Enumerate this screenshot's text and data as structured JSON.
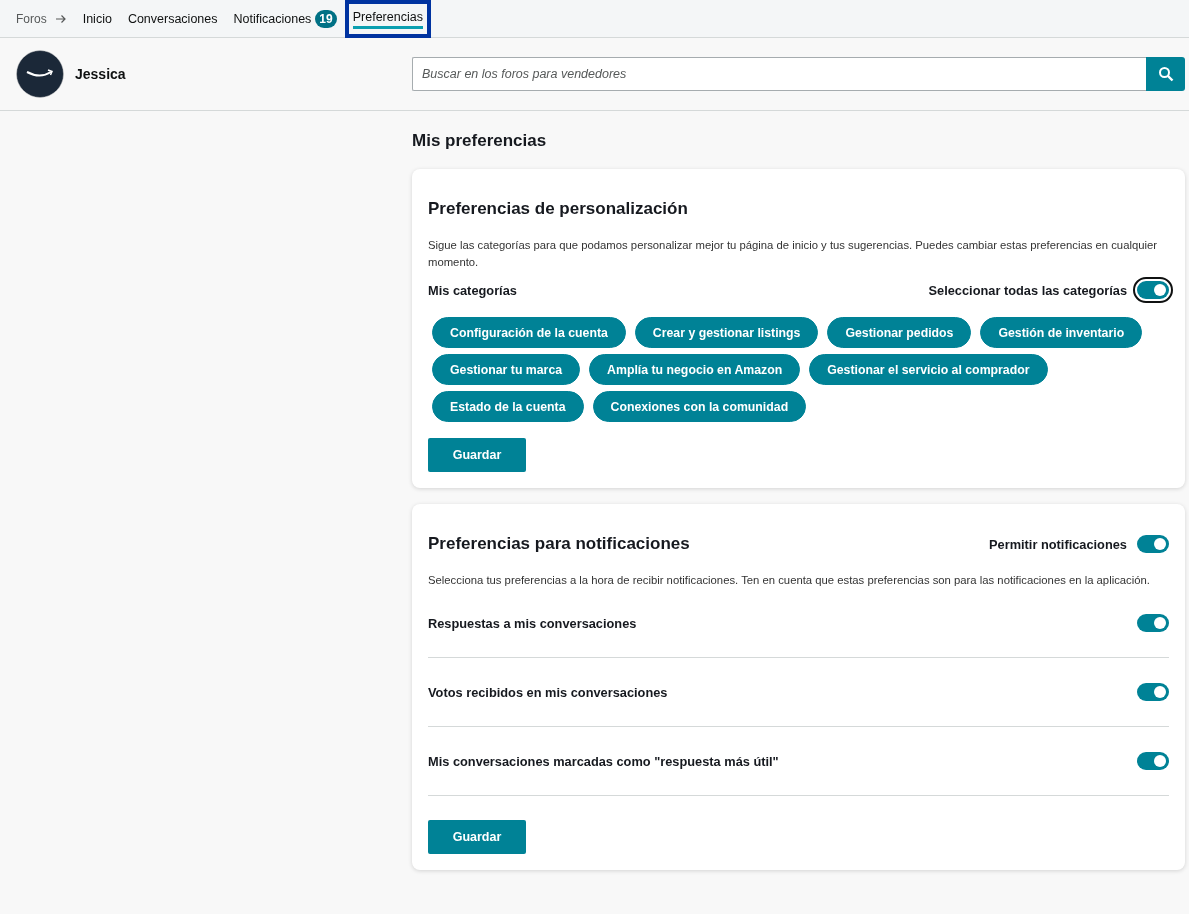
{
  "breadcrumb": {
    "root": "Foros",
    "items": [
      {
        "label": "Inicio",
        "selected": false,
        "focused": false
      },
      {
        "label": "Conversaciones",
        "selected": false,
        "focused": false
      },
      {
        "label": "Notificaciones",
        "badge": "19",
        "selected": false,
        "focused": false
      },
      {
        "label": "Preferencias",
        "selected": true,
        "focused": true
      }
    ]
  },
  "user": {
    "name": "Jessica"
  },
  "search": {
    "placeholder": "Buscar en los foros para vendedores"
  },
  "page_title": "Mis preferencias",
  "personalization": {
    "title": "Preferencias de personalización",
    "description": "Sigue las categorías para que podamos personalizar mejor tu página de inicio y tus sugerencias. Puedes cambiar estas preferencias en cualquier momento.",
    "categories_label": "Mis categorías",
    "select_all": {
      "label": "Seleccionar todas las categorías",
      "on": true,
      "focused": true
    },
    "categories": [
      {
        "label": "Configuración de la cuenta",
        "selected": true
      },
      {
        "label": "Crear y gestionar listings",
        "selected": true
      },
      {
        "label": "Gestionar pedidos",
        "selected": true
      },
      {
        "label": "Gestión de inventario",
        "selected": true
      },
      {
        "label": "Gestionar tu marca",
        "selected": true
      },
      {
        "label": "Amplía tu negocio en Amazon",
        "selected": true
      },
      {
        "label": "Gestionar el servicio al comprador",
        "selected": true
      },
      {
        "label": "Estado de la cuenta",
        "selected": true
      },
      {
        "label": "Conexiones con la comunidad",
        "selected": true
      }
    ],
    "save": "Guardar"
  },
  "notifications": {
    "title": "Preferencias para notificaciones",
    "allow": {
      "label": "Permitir notificaciones",
      "on": true
    },
    "description": "Selecciona tus preferencias a la hora de recibir notificaciones. Ten en cuenta que estas preferencias son para las notificaciones en la aplicación.",
    "options": [
      {
        "label": "Respuestas a mis conversaciones",
        "on": true
      },
      {
        "label": "Votos recibidos en mis conversaciones",
        "on": true
      },
      {
        "label": "Mis conversaciones marcadas como \"respuesta más útil\"",
        "on": true
      }
    ],
    "save": "Guardar"
  }
}
